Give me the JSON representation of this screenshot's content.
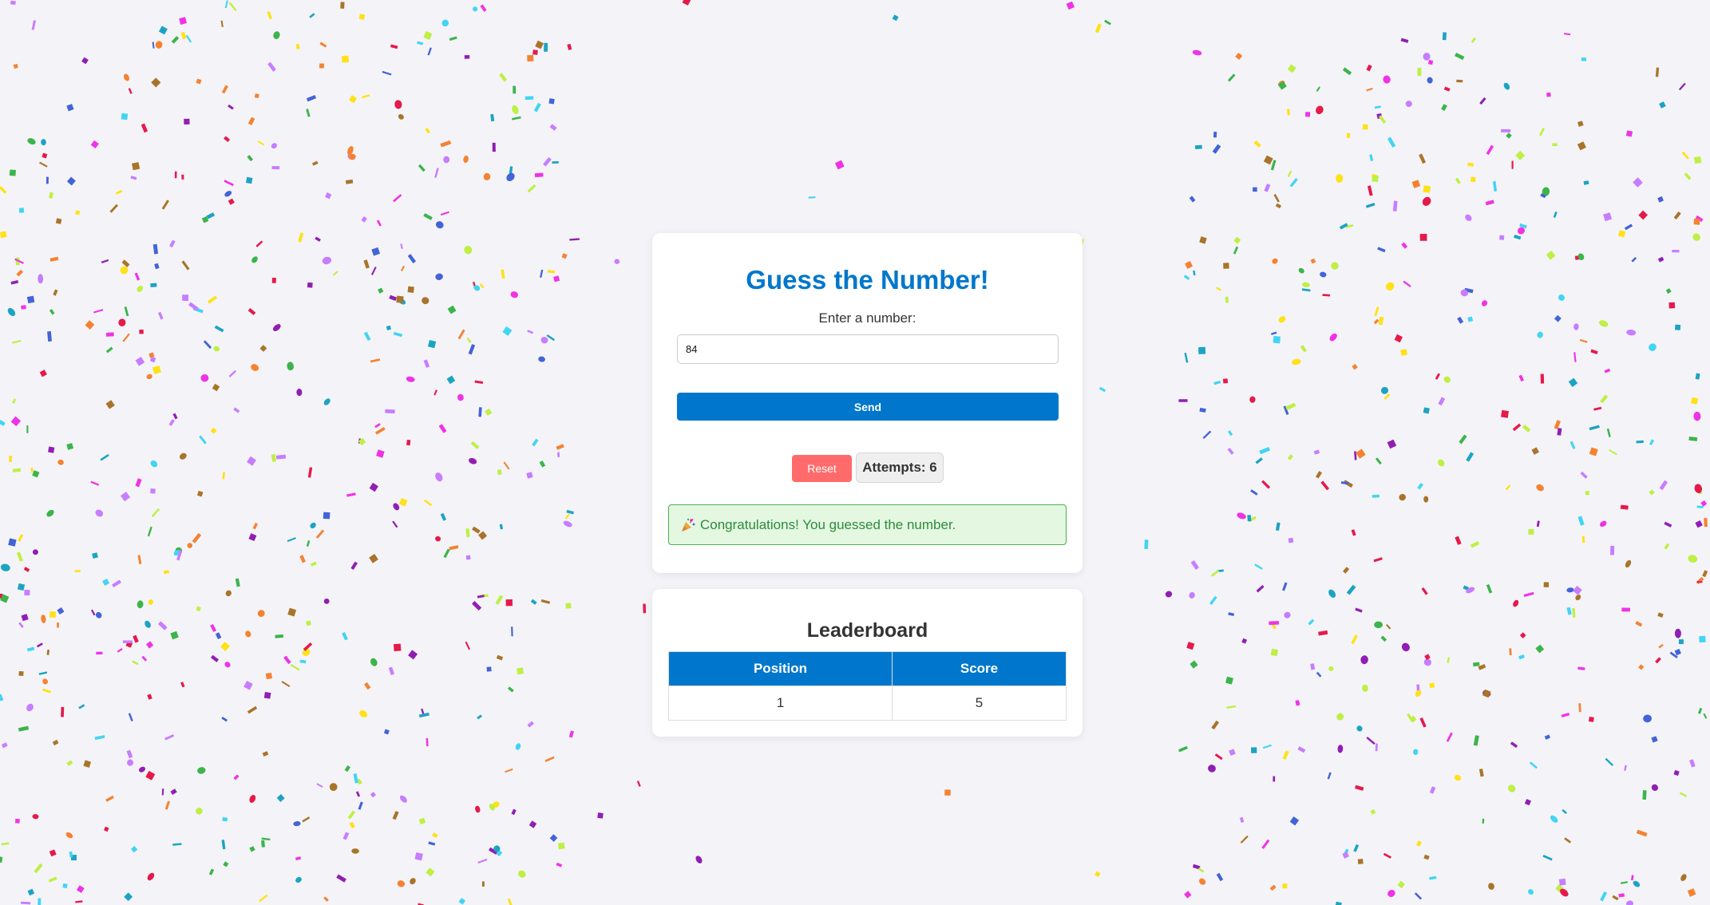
{
  "game": {
    "title": "Guess the Number!",
    "input_label": "Enter a number:",
    "input_value": "84",
    "send_label": "Send",
    "reset_label": "Reset",
    "attempts_text": "Attempts: 6",
    "success_text": "Congratulations! You guessed the number."
  },
  "leaderboard": {
    "title": "Leaderboard",
    "columns": [
      "Position",
      "Score"
    ],
    "rows": [
      {
        "position": "1",
        "score": "5"
      }
    ]
  },
  "colors": {
    "primary": "#0077cc",
    "reset": "#ff6b6b",
    "success_bg": "#e3f7e1",
    "success_border": "#4caf50",
    "success_text": "#2e8b3d",
    "background": "#f4f4f8"
  },
  "confetti_colors": [
    "#e6194b",
    "#f58231",
    "#ffe119",
    "#bfef45",
    "#3cb44b",
    "#42d4f4",
    "#4363d8",
    "#911eb4",
    "#f032e6",
    "#a9742a",
    "#1ca3c4",
    "#c77dff"
  ]
}
